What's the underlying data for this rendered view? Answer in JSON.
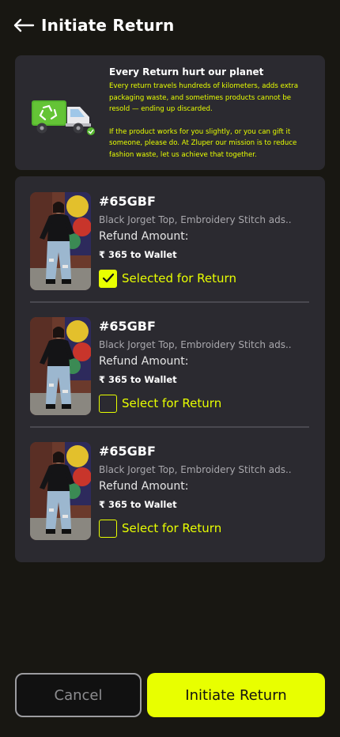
{
  "header": {
    "title": "Initiate Return",
    "back_icon": "arrow-left-icon"
  },
  "info": {
    "icon": "recycle-truck-icon",
    "title": "Every Return hurt our planet",
    "paragraph1": "Every return travels hundreds of kilometers, adds extra packaging waste, and sometimes products cannot be resold — ending up discarded.",
    "paragraph2": "If the product works for you slightly, or you can gift it someone, please do. At Zluper our mission is to reduce fashion waste, let us achieve that together."
  },
  "items": [
    {
      "order_id": "#65GBF",
      "description": "Black Jorget Top, Embroidery Stitch ads..",
      "refund_label": "Refund Amount:",
      "refund_value": "₹ 365 to Wallet",
      "select_label": "Selected for Return",
      "selected": true
    },
    {
      "order_id": "#65GBF",
      "description": "Black Jorget Top, Embroidery Stitch ads..",
      "refund_label": "Refund Amount:",
      "refund_value": "₹ 365 to Wallet",
      "select_label": "Select for Return",
      "selected": false
    },
    {
      "order_id": "#65GBF",
      "description": "Black Jorget Top, Embroidery Stitch ads..",
      "refund_label": "Refund Amount:",
      "refund_value": "₹ 365 to Wallet",
      "select_label": "Select for Return",
      "selected": false
    }
  ],
  "footer": {
    "cancel_label": "Cancel",
    "initiate_label": "Initiate Return"
  },
  "colors": {
    "accent": "#e8ff00",
    "background": "#181712",
    "card": "#2b2a30"
  }
}
